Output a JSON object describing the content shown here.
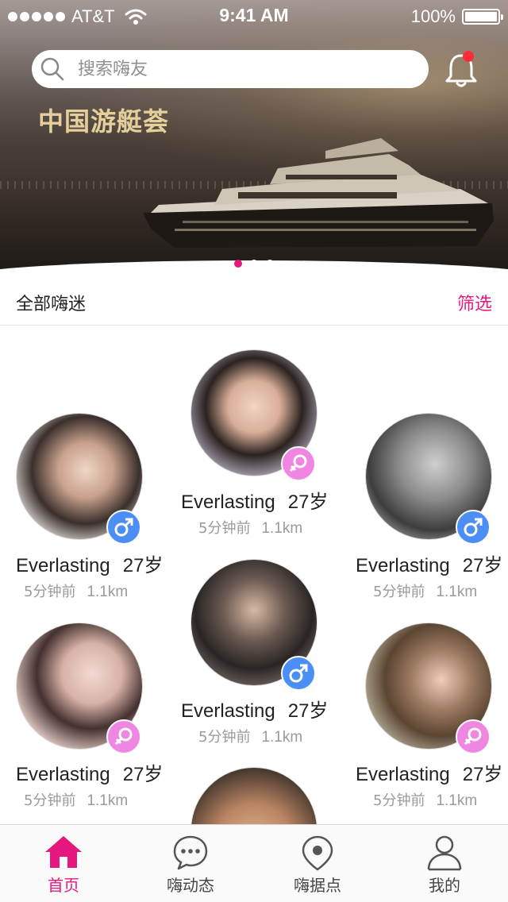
{
  "status_bar": {
    "carrier": "AT&T",
    "time": "9:41 AM",
    "battery": "100%"
  },
  "search": {
    "placeholder": "搜索嗨友"
  },
  "banner": {
    "title": "中国游艇荟",
    "page_count": 3,
    "active_index": 0
  },
  "section": {
    "title": "全部嗨迷",
    "filter_label": "筛选"
  },
  "users": [
    {
      "name": "Everlasting",
      "age": "27岁",
      "time": "5分钟前",
      "distance": "1.1km",
      "gender": "male"
    },
    {
      "name": "Everlasting",
      "age": "27岁",
      "time": "5分钟前",
      "distance": "1.1km",
      "gender": "female"
    },
    {
      "name": "Everlasting",
      "age": "27岁",
      "time": "5分钟前",
      "distance": "1.1km",
      "gender": "male"
    },
    {
      "name": "Everlasting",
      "age": "27岁",
      "time": "5分钟前",
      "distance": "1.1km",
      "gender": "female"
    },
    {
      "name": "Everlasting",
      "age": "27岁",
      "time": "5分钟前",
      "distance": "1.1km",
      "gender": "male"
    },
    {
      "name": "Everlasting",
      "age": "27岁",
      "time": "5分钟前",
      "distance": "1.1km",
      "gender": "female"
    }
  ],
  "tabs": [
    {
      "label": "首页",
      "icon": "home-icon",
      "active": true
    },
    {
      "label": "嗨动态",
      "icon": "chat-bubble-icon",
      "active": false
    },
    {
      "label": "嗨据点",
      "icon": "location-pin-icon",
      "active": false
    },
    {
      "label": "我的",
      "icon": "person-icon",
      "active": false
    }
  ],
  "colors": {
    "accent": "#e6177f",
    "male": "#4b8ef5",
    "female": "#ef86e2",
    "notification_dot": "#ff2b3a"
  }
}
